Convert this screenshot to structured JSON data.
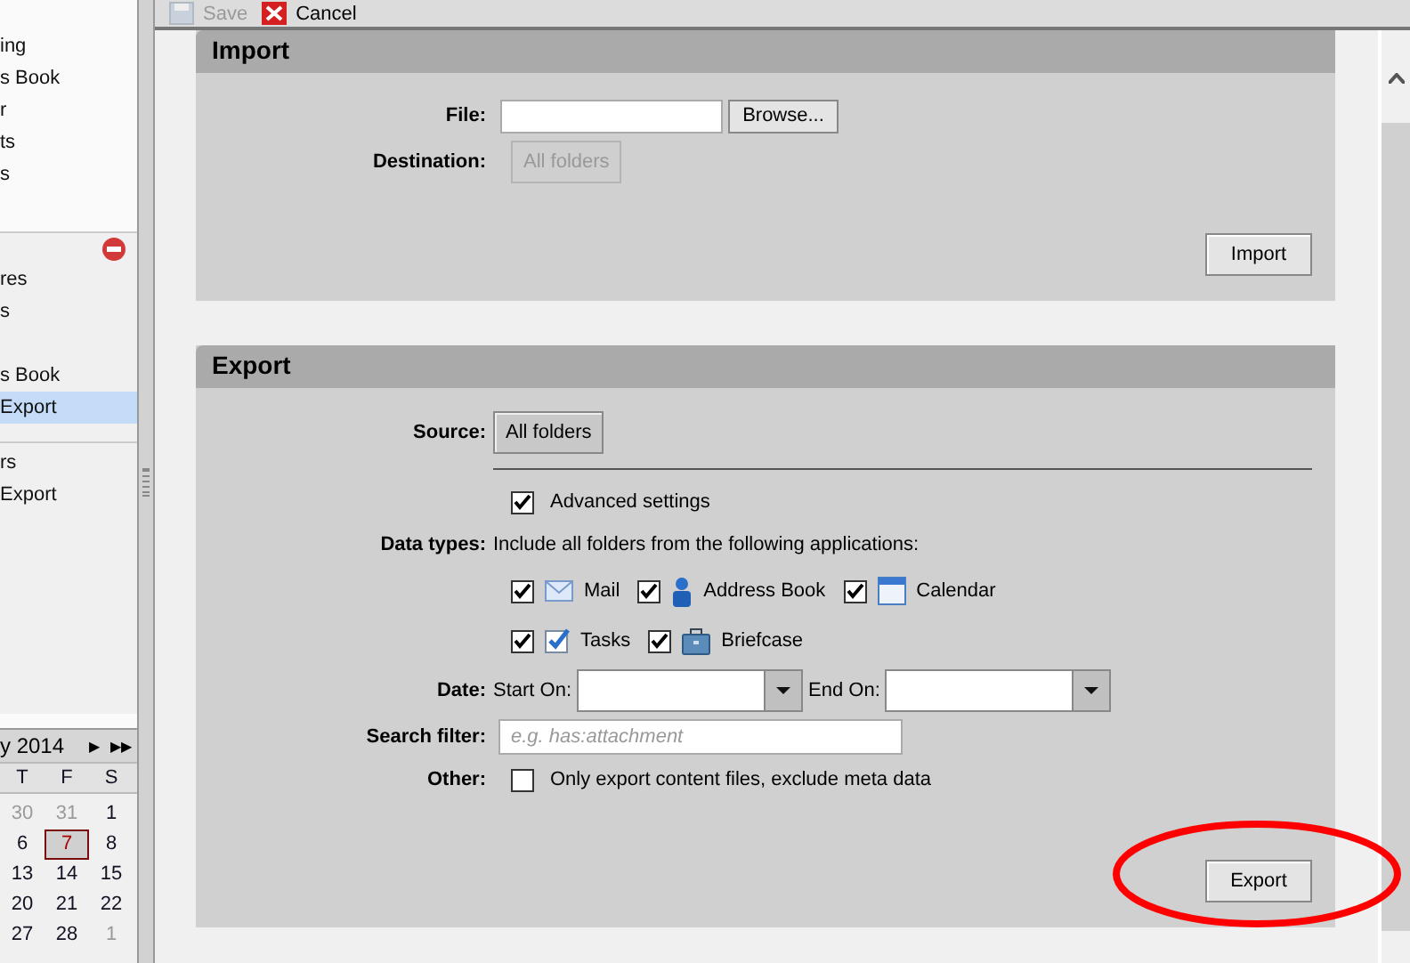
{
  "toolbar": [
    {
      "kind": "save",
      "label": "Save",
      "disabled": true
    },
    {
      "kind": "cancel",
      "label": "Cancel",
      "disabled": false
    }
  ],
  "sidebar": {
    "sections": [
      {
        "items": [
          {
            "label": "ing",
            "selected": false
          },
          {
            "label": "s Book",
            "selected": false
          },
          {
            "label": "r",
            "selected": false
          },
          {
            "label": "ts",
            "selected": false
          },
          {
            "label": "s",
            "selected": false
          }
        ]
      },
      {
        "items": [
          {
            "label": "res",
            "selected": false
          },
          {
            "label": "s",
            "selected": false
          },
          {
            "label": "s Book",
            "selected": false
          },
          {
            "label": "Export",
            "selected": true
          }
        ]
      },
      {
        "items": [
          {
            "label": "rs",
            "selected": false
          },
          {
            "label": "Export",
            "selected": false
          }
        ]
      }
    ]
  },
  "calendar": {
    "title": "y 2014",
    "next": "▶",
    "next_year": "▶▶",
    "weekdays": [
      "T",
      "F",
      "S"
    ],
    "weeks": [
      [
        {
          "day": "30",
          "other_month": true,
          "today": false
        },
        {
          "day": "31",
          "other_month": true,
          "today": false
        },
        {
          "day": "1",
          "other_month": false,
          "today": false
        }
      ],
      [
        {
          "day": "6",
          "other_month": false,
          "today": false
        },
        {
          "day": "7",
          "other_month": false,
          "today": true
        },
        {
          "day": "8",
          "other_month": false,
          "today": false
        }
      ],
      [
        {
          "day": "13",
          "other_month": false,
          "today": false
        },
        {
          "day": "14",
          "other_month": false,
          "today": false
        },
        {
          "day": "15",
          "other_month": false,
          "today": false
        }
      ],
      [
        {
          "day": "20",
          "other_month": false,
          "today": false
        },
        {
          "day": "21",
          "other_month": false,
          "today": false
        },
        {
          "day": "22",
          "other_month": false,
          "today": false
        }
      ],
      [
        {
          "day": "27",
          "other_month": false,
          "today": false
        },
        {
          "day": "28",
          "other_month": false,
          "today": false
        },
        {
          "day": "1",
          "other_month": true,
          "today": false
        }
      ]
    ]
  },
  "import": {
    "title": "Import",
    "file_label": "File:",
    "browse": "Browse...",
    "destination_label": "Destination:",
    "destination": {
      "label": "All folders",
      "disabled": true
    },
    "button": "Import"
  },
  "export": {
    "title": "Export",
    "source_label": "Source:",
    "source": {
      "label": "All folders",
      "disabled": false
    },
    "advanced": {
      "label": "Advanced settings",
      "checked": true
    },
    "data_types_label": "Data types:",
    "data_types_note": "Include all folders from the following applications:",
    "data_types": [
      [
        {
          "kind": "mail",
          "label": "Mail",
          "checked": true
        },
        {
          "kind": "contact",
          "label": "Address Book",
          "checked": true
        },
        {
          "kind": "calendar",
          "label": "Calendar",
          "checked": true
        }
      ],
      [
        {
          "kind": "tasks",
          "label": "Tasks",
          "checked": true
        },
        {
          "kind": "briefcase",
          "label": "Briefcase",
          "checked": true
        }
      ]
    ],
    "date_label": "Date:",
    "start_label": "Start On:",
    "end_label": "End On:",
    "search_label": "Search filter:",
    "search_placeholder": "e.g. has:attachment",
    "other_label": "Other:",
    "other": {
      "label": "Only export content files, exclude meta data",
      "checked": false
    },
    "button": "Export"
  }
}
